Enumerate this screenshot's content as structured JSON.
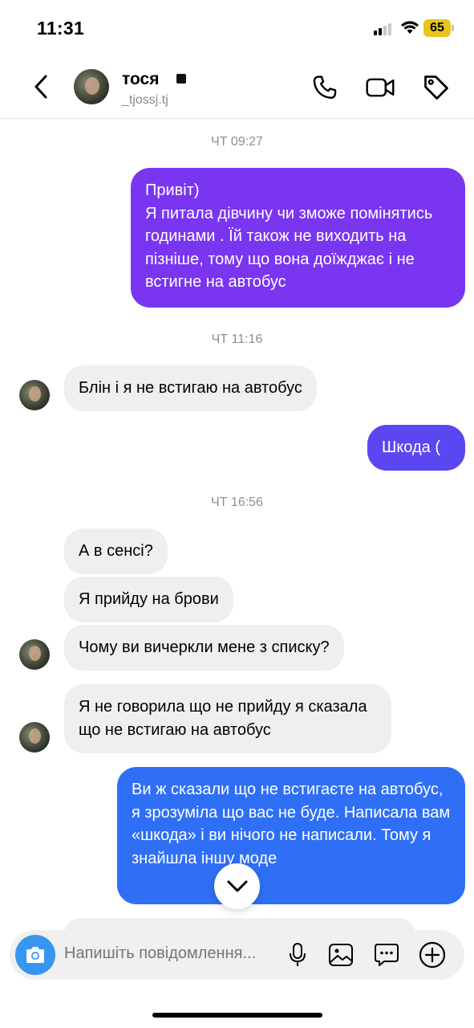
{
  "status_bar": {
    "time": "11:31",
    "battery": "65"
  },
  "header": {
    "name": "тося",
    "username": "_tjossj.tj"
  },
  "timestamps": [
    "ЧТ 09:27",
    "ЧТ 11:16",
    "ЧТ 16:56"
  ],
  "messages": [
    {
      "from": "me",
      "text": "Привіт)\nЯ питала дівчину чи зможе помінятись годинами . Їй також не виходить на пізніше, тому що вона доїжджає і не встигне на автобус"
    },
    {
      "from": "them",
      "text": "Блін і я не встигаю на автобус"
    },
    {
      "from": "me",
      "text": "Шкода ("
    },
    {
      "from": "them",
      "text": "А в сенсі?"
    },
    {
      "from": "them",
      "text": "Я прийду на брови"
    },
    {
      "from": "them",
      "text": "Чому ви вичеркли мене з списку?"
    },
    {
      "from": "them",
      "text": "Я не говорила що не прийду я сказала що не встигаю на автобус"
    },
    {
      "from": "me",
      "text": "Ви ж сказали що не встигаєте на автобус, я зрозуміла що вас не буде. Написала вам «шкода» і ви нічого не написали. Тому я знайшла іншу моде"
    }
  ],
  "composer": {
    "placeholder": "Напишіть повідомлення..."
  },
  "colors": {
    "outgoing_purple": "#7a35f1",
    "outgoing_violet": "#5b47ef",
    "outgoing_blue": "#2f6ff6",
    "incoming": "#efefef",
    "accent": "#3797f0"
  }
}
